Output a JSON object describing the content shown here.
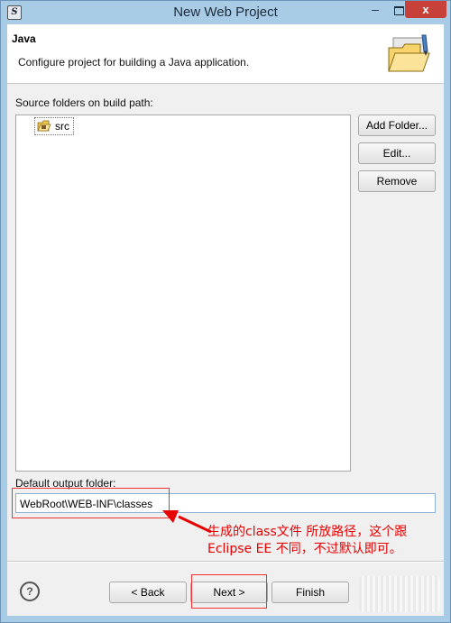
{
  "window": {
    "title": "New Web Project",
    "app_icon_glyph": "S"
  },
  "titlebar_controls": {
    "minimize": "–",
    "close": "x"
  },
  "header": {
    "title": "Java",
    "description": "Configure project for building a Java application.",
    "icon": "folder-wizard-icon"
  },
  "source": {
    "label": "Source folders on build path:",
    "items": [
      {
        "label": "src",
        "icon": "source-folder-icon"
      }
    ]
  },
  "side_buttons": {
    "add_folder": "Add Folder...",
    "edit": "Edit...",
    "remove": "Remove"
  },
  "output": {
    "label": "Default output folder:",
    "value": "WebRoot\\WEB-INF\\classes"
  },
  "annotation": {
    "line1": "生成的class文件 所放路径，这个跟",
    "line2": "Eclipse EE 不同，不过默认即可。",
    "color": "#e60000"
  },
  "footer": {
    "help_glyph": "?",
    "back": "< Back",
    "next": "Next >",
    "finish": "Finish"
  },
  "colors": {
    "frame": "#a8cbe6",
    "close": "#c7403a",
    "dialog": "#f0f0f0"
  }
}
